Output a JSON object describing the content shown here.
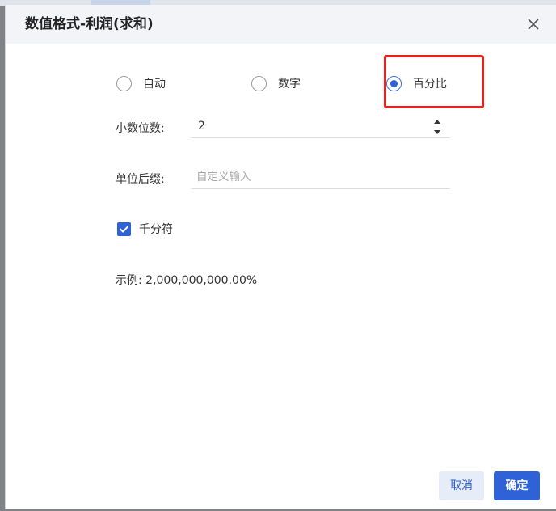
{
  "dialog": {
    "title": "数值格式-利润(求和)"
  },
  "format_options": [
    {
      "label": "自动",
      "checked": false
    },
    {
      "label": "数字",
      "checked": false
    },
    {
      "label": "百分比",
      "checked": true
    }
  ],
  "decimal_places": {
    "label": "小数位数:",
    "value": "2"
  },
  "unit_suffix": {
    "label": "单位后缀:",
    "placeholder": "自定义输入",
    "value": ""
  },
  "thousands_separator": {
    "label": "千分符",
    "checked": true
  },
  "example": {
    "text": "示例: 2,000,000,000.00%"
  },
  "buttons": {
    "cancel": "取消",
    "ok": "确定"
  },
  "colors": {
    "accent": "#2f62d6",
    "highlight": "#e8211c"
  }
}
